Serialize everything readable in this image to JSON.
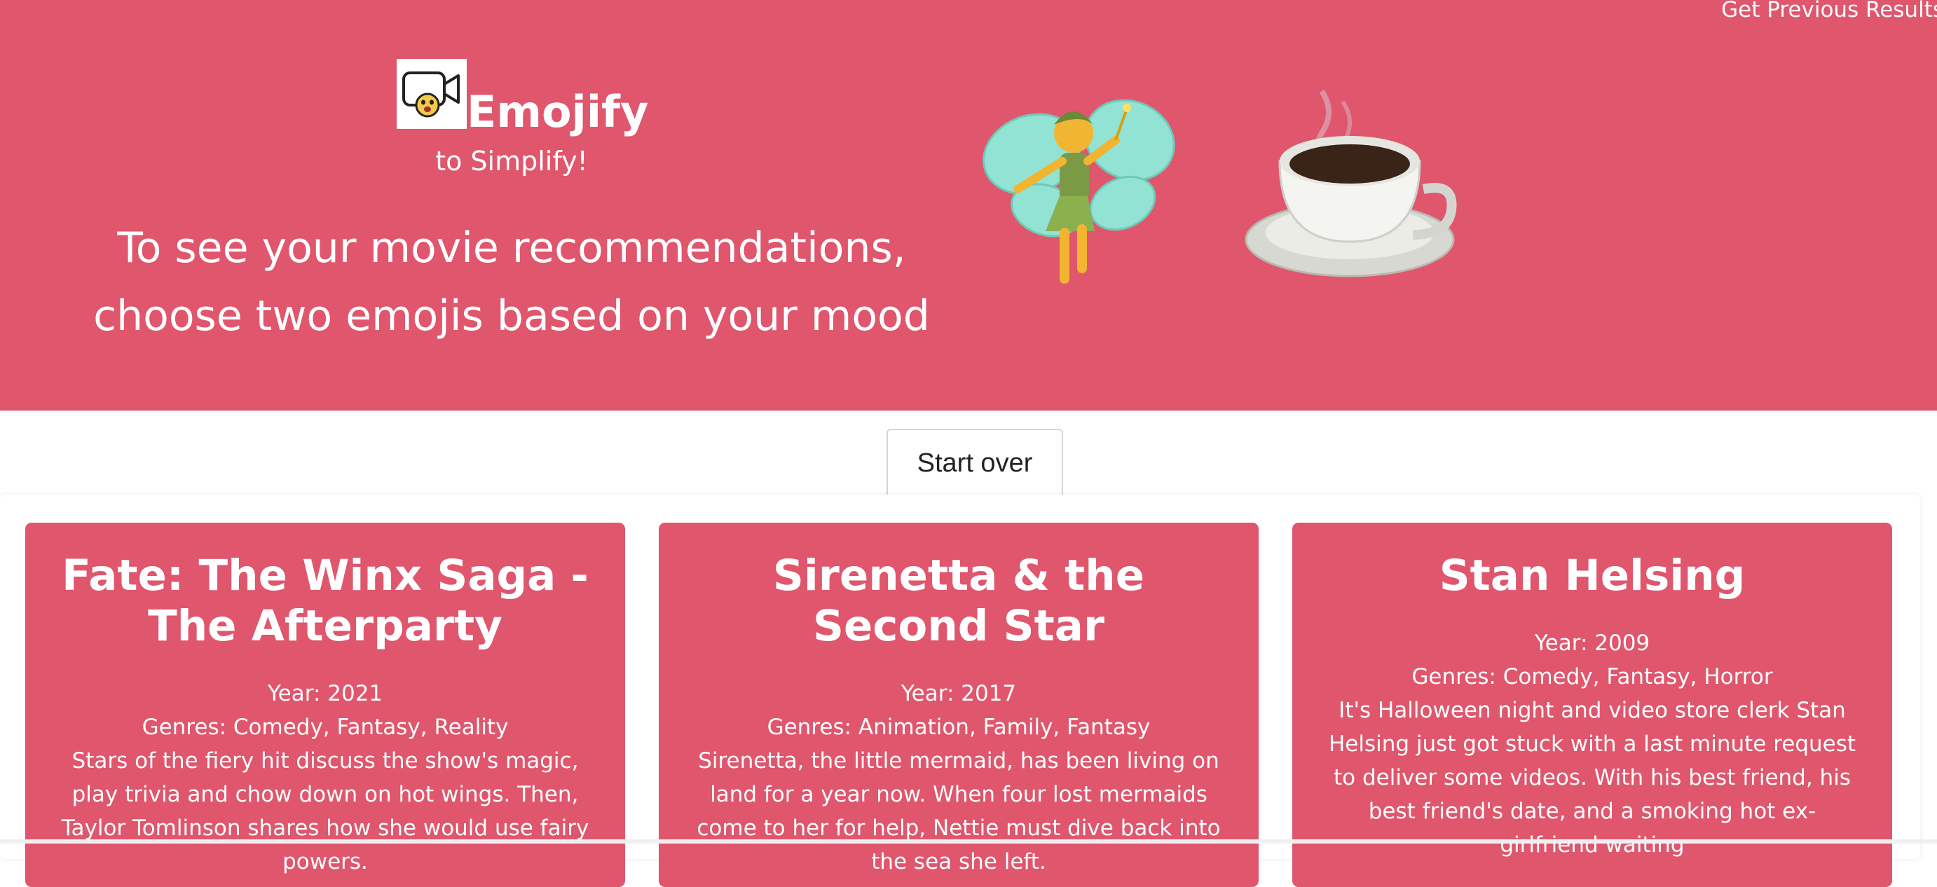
{
  "header": {
    "previous_link": "Get Previous Results",
    "brand_name": "Emojify",
    "tagline": "to Simplify!",
    "instruction_line1": "To see your movie recommendations,",
    "instruction_line2": "choose two emojis based on your mood",
    "selected_emojis": [
      "fairy-emoji",
      "hot-beverage-emoji"
    ]
  },
  "controls": {
    "start_over_label": "Start over"
  },
  "movies": [
    {
      "title": "Fate: The Winx Saga - The Afterparty",
      "year": "Year: 2021",
      "genres": "Genres: Comedy, Fantasy, Reality",
      "description": "Stars of the fiery hit discuss the show's magic, play trivia and chow down on hot wings. Then, Taylor Tomlinson shares how she would use fairy powers."
    },
    {
      "title": "Sirenetta & the Second Star",
      "year": "Year: 2017",
      "genres": "Genres: Animation, Family, Fantasy",
      "description": "Sirenetta, the little mermaid, has been living on land for a year now. When four lost mermaids come to her for help, Nettie must dive back into the sea she left."
    },
    {
      "title": "Stan Helsing",
      "year": "Year: 2009",
      "genres": "Genres: Comedy, Fantasy, Horror",
      "description": "It's Halloween night and video store clerk Stan Helsing just got stuck with a last minute request to deliver some videos. With his best friend, his best friend's date, and a smoking hot ex-girlfriend waiting"
    }
  ],
  "colors": {
    "brand": "#df566d",
    "text_on_brand": "#ffffff"
  }
}
